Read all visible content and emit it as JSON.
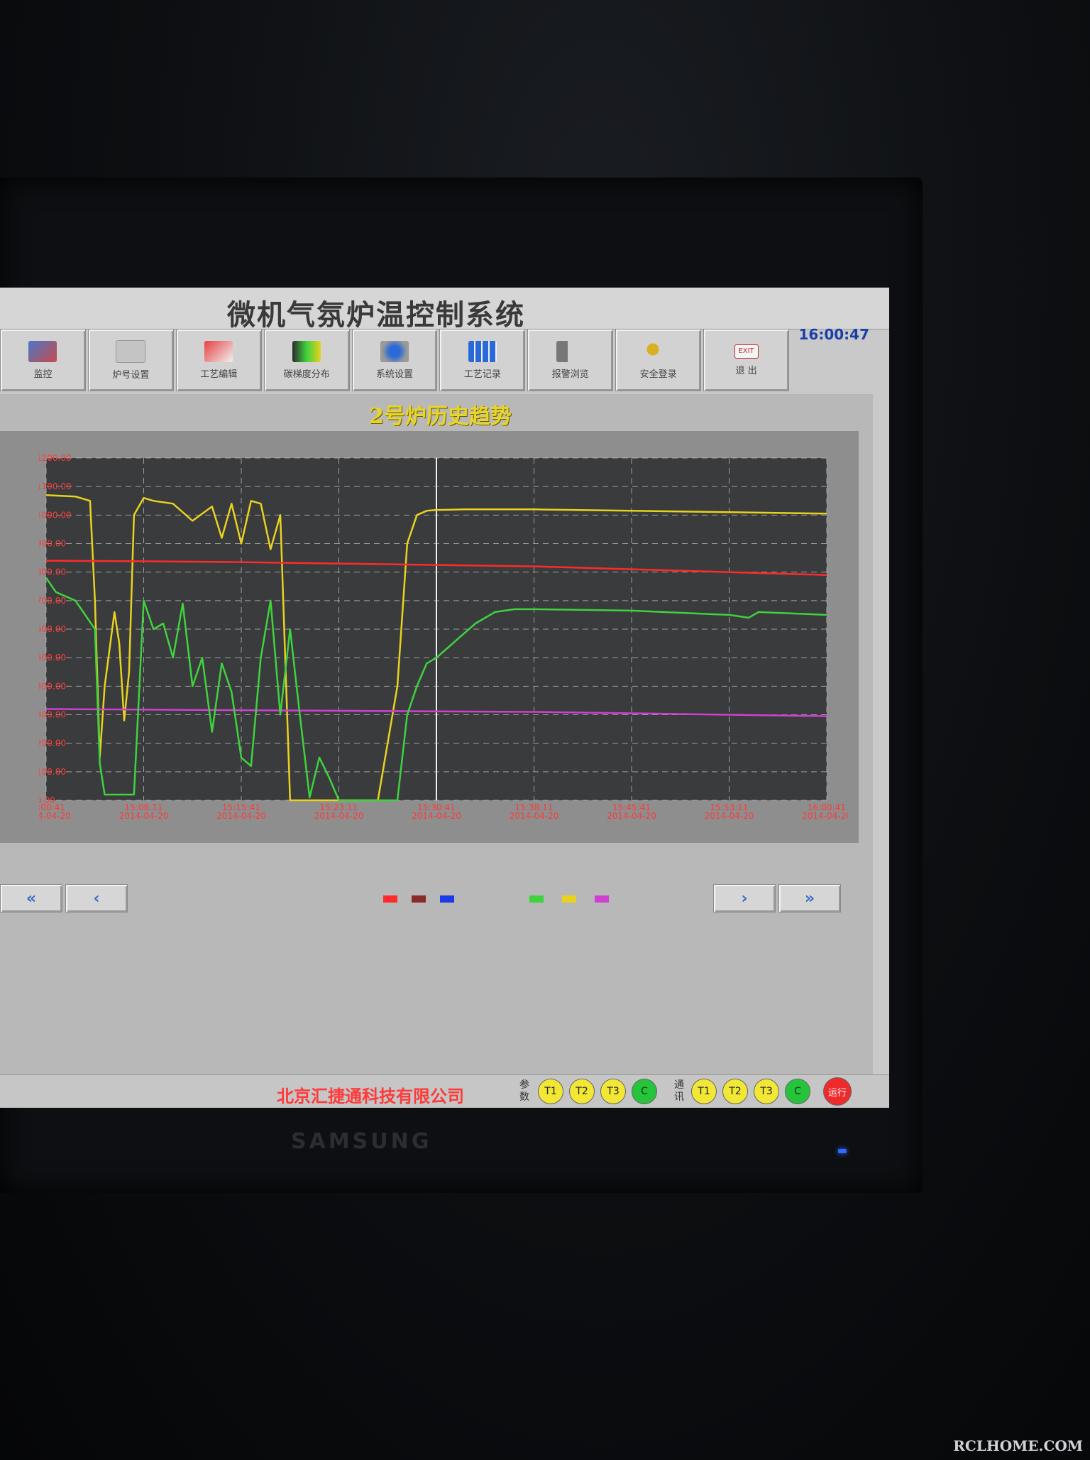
{
  "window": {
    "title": "微机气氛炉温控制系统",
    "clock": "16:00:47"
  },
  "toolbar": {
    "items": [
      {
        "label": "监控",
        "icon": "furnace-monitor-icon"
      },
      {
        "label": "炉号设置",
        "icon": "blank-panel-icon"
      },
      {
        "label": "工艺编辑",
        "icon": "process-edit-icon"
      },
      {
        "label": "碳梯度分布",
        "icon": "carbon-gradient-icon"
      },
      {
        "label": "系统设置",
        "icon": "system-settings-icon"
      },
      {
        "label": "工艺记录",
        "icon": "process-record-icon"
      },
      {
        "label": "报警浏览",
        "icon": "alarm-speaker-icon"
      },
      {
        "label": "安全登录",
        "icon": "key-login-icon"
      },
      {
        "label": "退 出",
        "icon": "exit-sign-icon",
        "badge": "EXIT"
      }
    ]
  },
  "trend": {
    "title": "2号炉历史趋势"
  },
  "chart_data": {
    "type": "line",
    "ylim": [
      0,
      1200
    ],
    "y_ticks": [
      "0.00",
      "100.00",
      "200.00",
      "300.00",
      "400.00",
      "500.00",
      "600.00",
      "700.00",
      "800.00",
      "900.00",
      "1000.00",
      "1100.00",
      "1200.00"
    ],
    "x_ticks": [
      {
        "time": "15:00:41",
        "date": "2014-04-20"
      },
      {
        "time": "15:08:11",
        "date": "2014-04-20"
      },
      {
        "time": "15:15:41",
        "date": "2014-04-20"
      },
      {
        "time": "15:23:11",
        "date": "2014-04-20"
      },
      {
        "time": "15:30:41",
        "date": "2014-04-20"
      },
      {
        "time": "15:38:11",
        "date": "2014-04-20"
      },
      {
        "time": "15:45:41",
        "date": "2014-04-20"
      },
      {
        "time": "15:53:11",
        "date": "2014-04-20"
      },
      {
        "time": "16:00:41",
        "date": "2014-04-20"
      }
    ],
    "x_unit": "MIN",
    "cursor_x": 4.0,
    "series": [
      {
        "color": "#e8d21e",
        "x": [
          0,
          0.3,
          0.45,
          0.5,
          0.55,
          0.6,
          0.7,
          0.75,
          0.8,
          0.85,
          0.9,
          1.0,
          1.1,
          1.3,
          1.5,
          1.7,
          1.8,
          1.9,
          2.0,
          2.1,
          2.2,
          2.3,
          2.4,
          2.5,
          2.6,
          2.7,
          2.8,
          2.9,
          3.0,
          3.2,
          3.4,
          3.6,
          3.7,
          3.8,
          3.9,
          4.0,
          4.3,
          5.0,
          6.0,
          7.0,
          8.0
        ],
        "y": [
          1070,
          1065,
          1050,
          700,
          150,
          400,
          660,
          550,
          280,
          450,
          1000,
          1060,
          1050,
          1040,
          980,
          1030,
          920,
          1040,
          900,
          1050,
          1040,
          880,
          1000,
          0,
          0,
          0,
          0,
          0,
          0,
          0,
          0,
          400,
          900,
          1000,
          1015,
          1018,
          1020,
          1020,
          1015,
          1010,
          1005
        ]
      },
      {
        "color": "#ff2a2a",
        "x": [
          0,
          1,
          2,
          3,
          4,
          5,
          6,
          7,
          8
        ],
        "y": [
          840,
          838,
          835,
          830,
          825,
          820,
          810,
          800,
          790
        ]
      },
      {
        "color": "#d040d0",
        "x": [
          0,
          1,
          2,
          3,
          4,
          5,
          6,
          7,
          8
        ],
        "y": [
          320,
          318,
          316,
          314,
          312,
          310,
          305,
          300,
          295
        ]
      },
      {
        "color": "#3fd23f",
        "x": [
          0,
          0.1,
          0.3,
          0.5,
          0.55,
          0.6,
          0.7,
          0.8,
          0.9,
          1.0,
          1.1,
          1.2,
          1.3,
          1.4,
          1.5,
          1.6,
          1.7,
          1.8,
          1.9,
          2.0,
          2.1,
          2.2,
          2.3,
          2.4,
          2.5,
          2.6,
          2.7,
          2.8,
          2.9,
          3.0,
          3.2,
          3.4,
          3.5,
          3.6,
          3.7,
          3.8,
          3.9,
          4.0,
          4.2,
          4.4,
          4.6,
          4.8,
          5.0,
          6.0,
          7.0,
          7.2,
          7.3,
          8.0
        ],
        "y": [
          780,
          730,
          700,
          600,
          130,
          20,
          20,
          20,
          20,
          700,
          600,
          620,
          500,
          690,
          400,
          500,
          240,
          480,
          380,
          150,
          120,
          500,
          700,
          300,
          600,
          300,
          10,
          150,
          80,
          0,
          0,
          0,
          0,
          0,
          300,
          400,
          480,
          500,
          560,
          620,
          660,
          670,
          670,
          665,
          650,
          640,
          660,
          650
        ]
      }
    ]
  },
  "nav": {
    "first": "«",
    "prev": "‹",
    "next": "›",
    "last": "»",
    "legend_colors": [
      "#ff2a2a",
      "#8a2a2a",
      "#1a3ae8",
      "#3fd23f",
      "#e8d21e",
      "#d040d0"
    ]
  },
  "status": {
    "company": "北京汇捷通科技有限公司",
    "param_label": "参数",
    "comm_label": "通讯",
    "param_indicators": [
      {
        "label": "T1",
        "state": "yellow"
      },
      {
        "label": "T2",
        "state": "yellow"
      },
      {
        "label": "T3",
        "state": "yellow"
      },
      {
        "label": "C",
        "state": "green"
      }
    ],
    "comm_indicators": [
      {
        "label": "T1",
        "state": "yellow"
      },
      {
        "label": "T2",
        "state": "yellow"
      },
      {
        "label": "T3",
        "state": "yellow"
      },
      {
        "label": "C",
        "state": "green"
      }
    ],
    "run_label": "运行"
  },
  "monitor": {
    "brand": "SAMSUNG"
  },
  "watermark": "RCLHOME.COM"
}
